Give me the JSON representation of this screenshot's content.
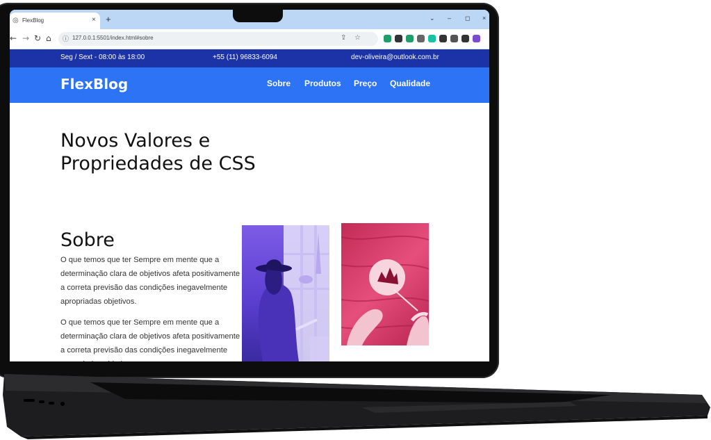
{
  "browser": {
    "tab_title": "FlexBlog",
    "tab_close": "×",
    "new_tab": "+",
    "url": "127.0.0.1:5501/index.html#sobre",
    "window_minimize": "–",
    "window_maximize": "◻",
    "window_close": "×",
    "nav_icons": [
      "back-icon",
      "forward-icon",
      "reload-icon",
      "home-icon"
    ],
    "extension_colors": [
      "#1f9d6b",
      "#333333",
      "#1f9d6b",
      "#666666",
      "#16c2a3",
      "#333333",
      "#555555",
      "#333333",
      "#7b4bd1"
    ]
  },
  "page": {
    "topbar": {
      "hours": "Seg / Sext - 08:00 às 18:00",
      "phone": "+55 (11) 96833-6094",
      "email": "dev-oliveira@outlook.com.br"
    },
    "header": {
      "logo": "FlexBlog",
      "nav": [
        "Sobre",
        "Produtos",
        "Preço",
        "Qualidade"
      ]
    },
    "hero": {
      "title_line1": "Novos Valores e",
      "title_line2": "Propriedades de CSS"
    },
    "about": {
      "title": "Sobre",
      "paragraph1": "O que temos que ter Sempre em mente que a determinação clara de objetivos afeta positivamente a correta previsão das condições inegavelmente apropriadas objetivos.",
      "paragraph2": "O que temos que ter Sempre em mente que a determinação clara de objetivos afeta positivamente a correta previsão das condições inegavelmente apropriadas objetivos."
    }
  },
  "colors": {
    "topbar": "#1c33a8",
    "header": "#2d73f5",
    "image_purple": "#6a4be0",
    "image_pink": "#d93864"
  }
}
